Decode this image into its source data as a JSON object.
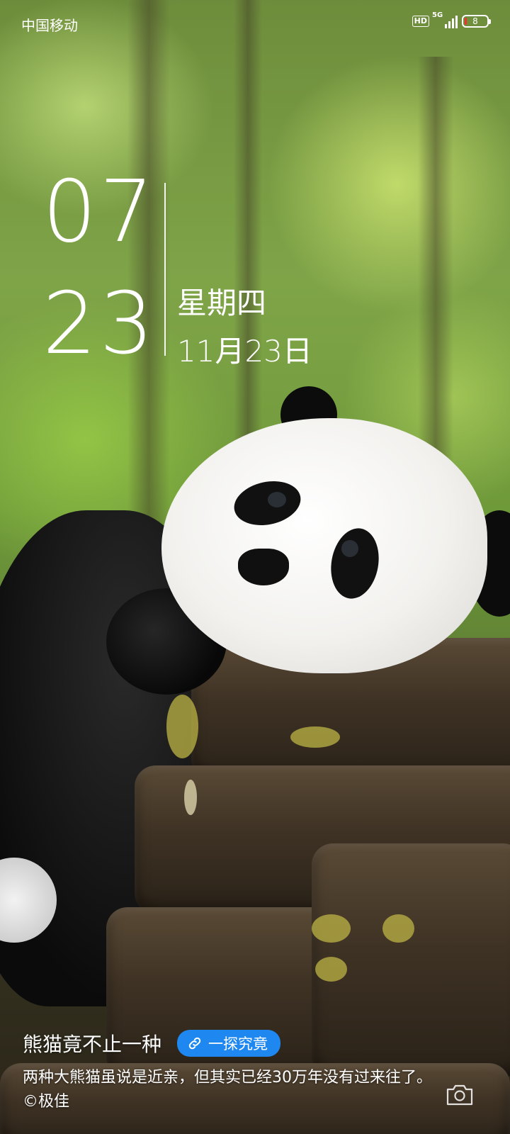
{
  "status_bar": {
    "carrier": "中国移动",
    "hd_label": "HD",
    "network": "5G",
    "battery": "8"
  },
  "clock": {
    "hour": "07",
    "minute": "23",
    "weekday": "星期四",
    "date": "11月23日"
  },
  "wallpaper": {
    "title": "熊猫竟不止一种",
    "button_label": "一探究竟",
    "description": "两种大熊猫虽说是近亲，但其实已经30万年没有过来往了。©极佳"
  },
  "icons": {
    "link": "link-icon",
    "camera": "camera-icon"
  },
  "colors": {
    "accent": "#1e88f0"
  }
}
